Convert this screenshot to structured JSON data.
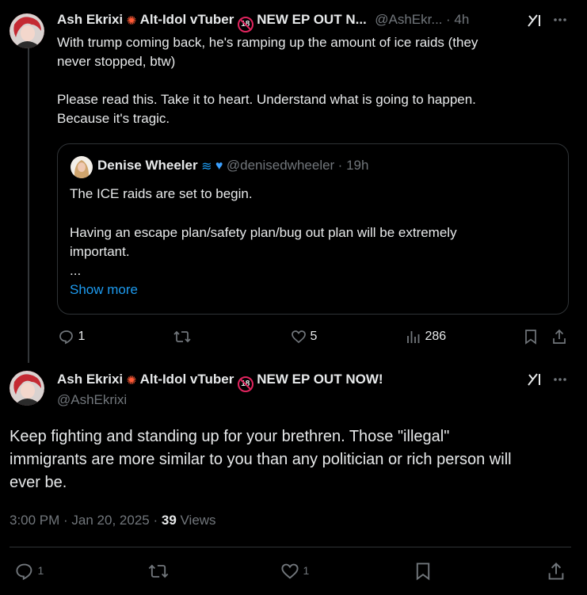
{
  "tweet1": {
    "author_name": "Ash Ekrixi",
    "author_tagline": "Alt-Idol vTuber",
    "author_badge": "18",
    "author_suffix": "NEW EP OUT N...",
    "handle": "@AshEkr...",
    "time": "4h",
    "text_line1": "With trump coming back, he's ramping up the amount of ice raids (they",
    "text_line2": "never stopped, btw)",
    "text_line3": "Please read this. Take it to heart. Understand what is going to happen.",
    "text_line4": "Because it's tragic.",
    "quote": {
      "author_name": "Denise Wheeler",
      "handle": "@denisedwheeler",
      "time": "19h",
      "line1": "The ICE raids are set to begin.",
      "line2": "Having an escape plan/safety plan/bug out plan will be extremely",
      "line3": "important.",
      "line4": "...",
      "show_more": "Show more"
    },
    "replies": "1",
    "likes": "5",
    "views": "286"
  },
  "tweet2": {
    "author_name": "Ash Ekrixi",
    "author_tagline": "Alt-Idol vTuber",
    "author_badge": "18",
    "author_suffix": "NEW EP OUT NOW!",
    "handle": "@AshEkrixi",
    "text_line1": "Keep fighting and standing up for your brethren. Those \"illegal\"",
    "text_line2": "immigrants are more similar to you than any politician or rich person will",
    "text_line3": "ever be.",
    "timestamp": "3:00 PM · Jan 20, 2025",
    "views_count": "39",
    "views_label": "Views",
    "replies": "1",
    "likes": "1"
  },
  "icons": {
    "grok": "grok-icon",
    "more": "more-icon",
    "reply": "reply-icon",
    "retweet": "retweet-icon",
    "like": "like-icon",
    "views": "views-icon",
    "bookmark": "bookmark-icon",
    "share": "share-icon"
  },
  "colors": {
    "background": "#000000",
    "text": "#e7e9ea",
    "muted": "#71767b",
    "link": "#1d9bf0",
    "border": "#2f3336"
  }
}
